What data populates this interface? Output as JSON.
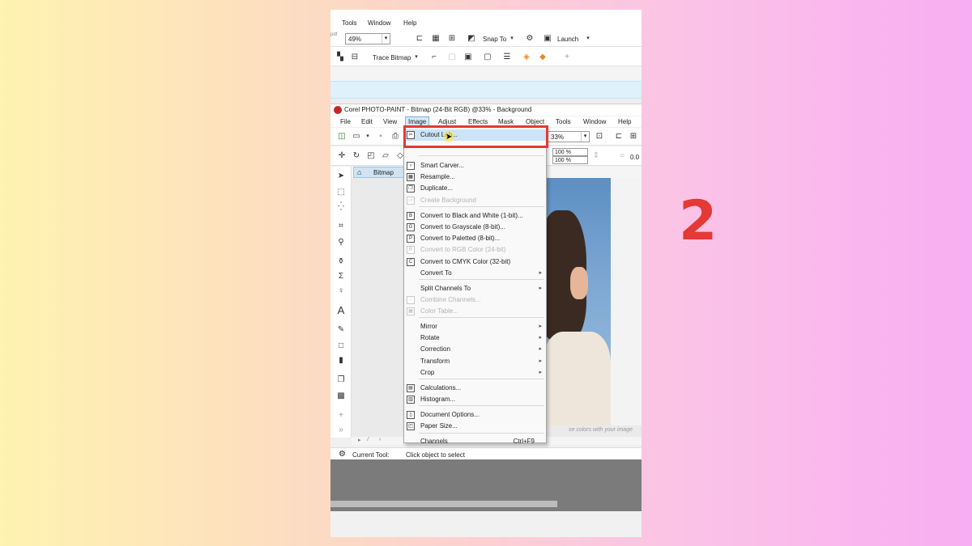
{
  "step_number": "2",
  "host_app": {
    "menu": [
      "Tools",
      "Window",
      "Help"
    ],
    "toolbar1": {
      "zoom_value": "49%",
      "snap_to": "Snap To",
      "launch": "Launch",
      "small_label": "pdf"
    },
    "toolbar2": {
      "trace_bitmap": "Trace Bitmap"
    }
  },
  "photo_paint": {
    "title": "Corel PHOTO-PAINT - Bitmap (24-Bit RGB) @33% - Background",
    "menu": [
      {
        "label": "File",
        "active": false
      },
      {
        "label": "Edit",
        "active": false
      },
      {
        "label": "View",
        "active": false
      },
      {
        "label": "Image",
        "active": true
      },
      {
        "label": "Adjust",
        "active": false
      },
      {
        "label": "Effects",
        "active": false
      },
      {
        "label": "Mask",
        "active": false
      },
      {
        "label": "Object",
        "active": false
      },
      {
        "label": "Tools",
        "active": false
      },
      {
        "label": "Window",
        "active": false
      },
      {
        "label": "Help",
        "active": false
      }
    ],
    "toolbar": {
      "zoom_value": "33%",
      "scale_w": "100 %",
      "scale_h": "100 %",
      "value_right": "0.0"
    },
    "doc_tab": "Bitmap",
    "doc_hint": "se colors with your image",
    "status": {
      "label": "Current Tool:",
      "value": "Click object to select"
    }
  },
  "image_menu": {
    "items": [
      {
        "label": "Cutout Lab...",
        "icon": "cutout-lab-icon",
        "glyph": "✂",
        "highlight": true
      },
      {
        "label": "Smart Carver...",
        "icon": "smart-carver-icon",
        "glyph": "♁"
      },
      {
        "label": "Resample...",
        "icon": "resample-icon",
        "glyph": "▦"
      },
      {
        "label": "Duplicate...",
        "icon": "duplicate-icon",
        "glyph": "❐"
      },
      {
        "label": "Create Background",
        "icon": "create-background-icon",
        "glyph": "▭",
        "disabled": true
      },
      {
        "label": "Convert to Black and White (1-bit)...",
        "icon": "bw-icon",
        "glyph": "B"
      },
      {
        "label": "Convert to Grayscale (8-bit)...",
        "icon": "grayscale-icon",
        "glyph": "G"
      },
      {
        "label": "Convert to Paletted (8-bit)...",
        "icon": "paletted-icon",
        "glyph": "P"
      },
      {
        "label": "Convert to RGB Color (24-bit)",
        "icon": "rgb-icon",
        "glyph": "R",
        "disabled": true
      },
      {
        "label": "Convert to CMYK Color (32-bit)",
        "icon": "cmyk-icon",
        "glyph": "C"
      },
      {
        "label": "Convert To",
        "submenu": true
      },
      {
        "label": "Split Channels To",
        "submenu": true
      },
      {
        "label": "Combine Channels...",
        "icon": "combine-channels-icon",
        "glyph": "⁞",
        "disabled": true
      },
      {
        "label": "Color Table...",
        "icon": "color-table-icon",
        "glyph": "▦",
        "disabled": true
      },
      {
        "label": "Mirror",
        "submenu": true
      },
      {
        "label": "Rotate",
        "submenu": true
      },
      {
        "label": "Correction",
        "submenu": true
      },
      {
        "label": "Transform",
        "submenu": true
      },
      {
        "label": "Crop",
        "submenu": true
      },
      {
        "label": "Calculations...",
        "icon": "calculations-icon",
        "glyph": "▤"
      },
      {
        "label": "Histogram...",
        "icon": "histogram-icon",
        "glyph": "▥"
      },
      {
        "label": "Document Options...",
        "icon": "document-options-icon",
        "glyph": "▯"
      },
      {
        "label": "Paper Size...",
        "icon": "paper-size-icon",
        "glyph": "◰"
      },
      {
        "label": "Channels",
        "shortcut": "Ctrl+F9"
      }
    ]
  }
}
